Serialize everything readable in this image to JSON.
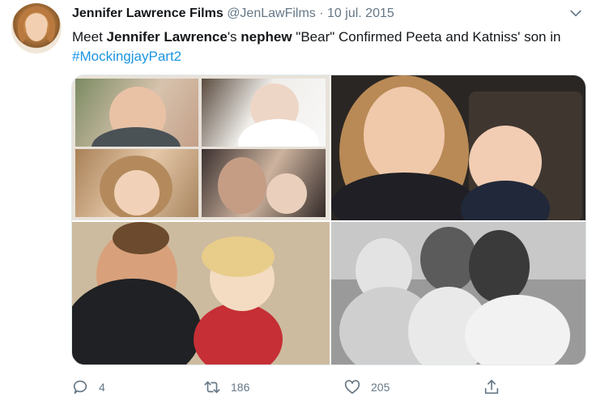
{
  "tweet": {
    "author_name": "Jennifer Lawrence Films",
    "handle": "@JenLawFilms",
    "separator": "·",
    "date": "10 jul. 2015",
    "text_parts": {
      "p1": "Meet ",
      "p2": "Jennifer Lawrence",
      "p3": "'s ",
      "p4": "nephew",
      "p5": " \"Bear\" Confirmed Peeta and Katniss' son in ",
      "hashtag": "#MockingjayPart2"
    }
  },
  "actions": {
    "reply_count": "4",
    "retweet_count": "186",
    "like_count": "205"
  },
  "icons": [
    "avatar",
    "chevron-down-icon",
    "reply-icon",
    "retweet-icon",
    "like-icon",
    "share-icon"
  ],
  "colors": {
    "text": "#14171a",
    "muted": "#657786",
    "link": "#1b95e0"
  }
}
